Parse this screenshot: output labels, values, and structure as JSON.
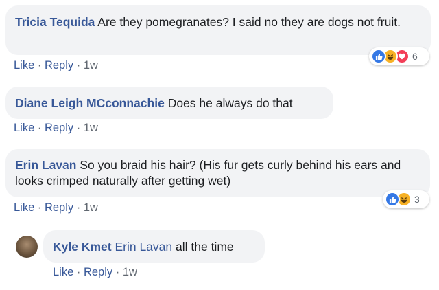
{
  "comments": [
    {
      "author": "Tricia Tequida",
      "text": "Are they pomegranates? I said no they are dogs not fruit.",
      "actions": {
        "like": "Like",
        "reply": "Reply",
        "time": "1w"
      },
      "reactions": {
        "types": [
          "like-icon",
          "haha-icon",
          "love-icon"
        ],
        "count": "6"
      }
    },
    {
      "author": "Diane Leigh MCconnachie",
      "text": "Does he always do that",
      "actions": {
        "like": "Like",
        "reply": "Reply",
        "time": "1w"
      }
    },
    {
      "author": "Erin Lavan",
      "text": "So you braid his hair? (His fur gets curly behind his ears and looks crimped naturally after getting wet)",
      "actions": {
        "like": "Like",
        "reply": "Reply",
        "time": "1w"
      },
      "reactions": {
        "types": [
          "like-icon",
          "haha-icon"
        ],
        "count": "3"
      }
    }
  ],
  "reply": {
    "author": "Kyle Kmet",
    "mention": "Erin Lavan",
    "text": "all the time",
    "actions": {
      "like": "Like",
      "reply": "Reply",
      "time": "1w"
    }
  },
  "separator": "·",
  "colors": {
    "link": "#385898",
    "bubble": "#f2f3f5",
    "like": "#3578e5",
    "haha": "#f7b125",
    "love": "#f33e58"
  }
}
